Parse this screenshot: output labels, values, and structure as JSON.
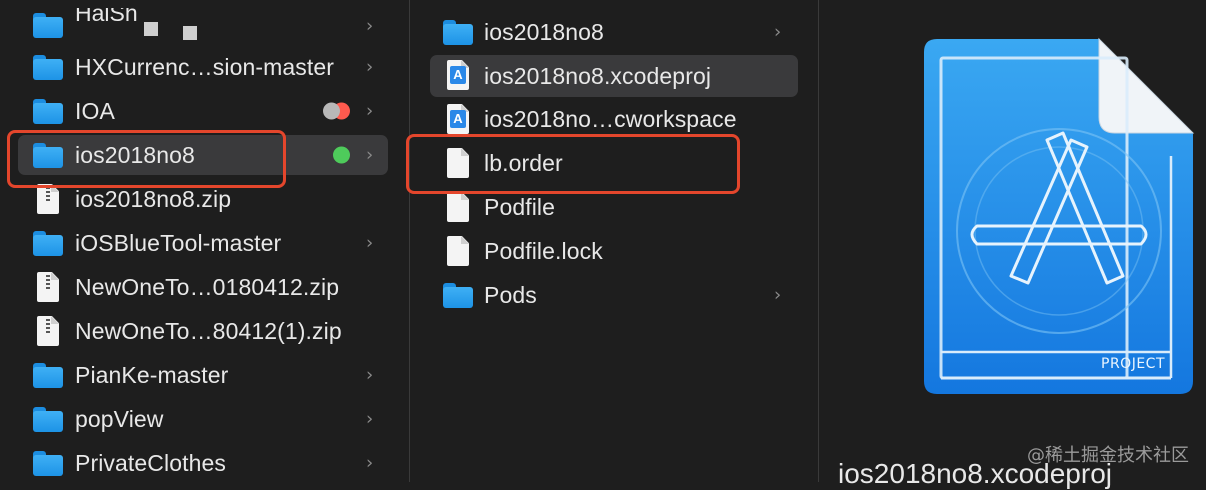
{
  "finder": {
    "column1": {
      "partial_top_label": "HalSh",
      "items": [
        {
          "name": "HXCurrenc…sion-master",
          "type": "folder",
          "chevron": true
        },
        {
          "name": "IOA",
          "type": "folder",
          "chevron": true,
          "tags": [
            "gray",
            "red"
          ]
        },
        {
          "name": "ios2018no8",
          "type": "folder",
          "chevron": true,
          "tags": [
            "green"
          ],
          "selected": true
        },
        {
          "name": "ios2018no8.zip",
          "type": "zip",
          "chevron": false
        },
        {
          "name": "iOSBlueTool-master",
          "type": "folder",
          "chevron": true
        },
        {
          "name": "NewOneTo…0180412.zip",
          "type": "zip",
          "chevron": false
        },
        {
          "name": "NewOneTo…80412(1).zip",
          "type": "zip",
          "chevron": false
        },
        {
          "name": "PianKe-master",
          "type": "folder",
          "chevron": true
        },
        {
          "name": "popView",
          "type": "folder",
          "chevron": true
        },
        {
          "name": "PrivateClothes",
          "type": "folder",
          "chevron": true
        }
      ]
    },
    "column2": {
      "items": [
        {
          "name": "ios2018no8",
          "type": "folder",
          "chevron": true
        },
        {
          "name": "ios2018no8.xcodeproj",
          "type": "xcodeproj",
          "chevron": false,
          "selected": true
        },
        {
          "name": "ios2018no…cworkspace",
          "type": "xcworkspace",
          "chevron": false
        },
        {
          "name": "lb.order",
          "type": "document",
          "chevron": false,
          "highlighted": true
        },
        {
          "name": "Podfile",
          "type": "document",
          "chevron": false
        },
        {
          "name": "Podfile.lock",
          "type": "document",
          "chevron": false
        },
        {
          "name": "Pods",
          "type": "folder",
          "chevron": true
        }
      ]
    },
    "preview": {
      "icon_label": "PROJECT",
      "caption": "ios2018no8.xcodeproj"
    },
    "watermark": "@稀土掘金技术社区",
    "chevron_glyph": "›"
  },
  "colors": {
    "background": "#1e1e1e",
    "selection_row": "#3a3a3c",
    "highlight_box": "#e4462c",
    "folder_blue": "#2a9ff0",
    "tag_green": "#4ecb5b",
    "tag_red": "#ff5a4e",
    "tag_gray": "#b8b8b8"
  }
}
